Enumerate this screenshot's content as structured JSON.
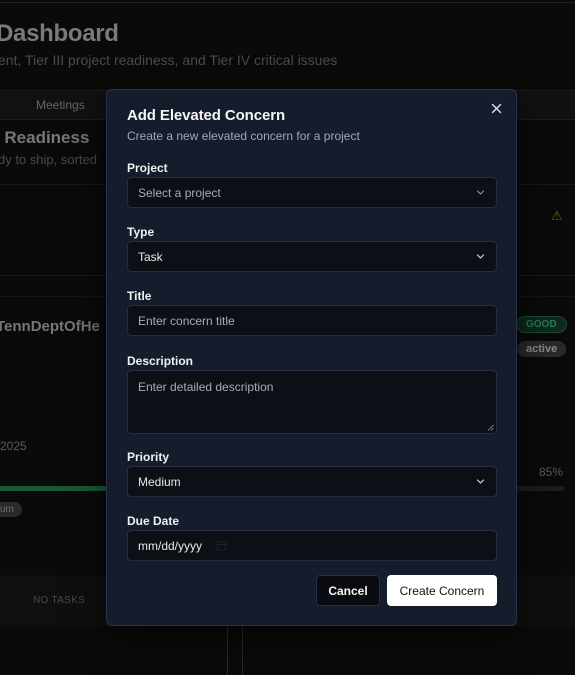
{
  "background": {
    "title": "Dashboard",
    "subtitle": "ent, Tier III project readiness, and Tier IV critical issues",
    "tab": "Meetings",
    "section_title": "t Readiness",
    "section_subtitle": "dy to ship, sorted",
    "project_name": "TennDeptOfHe",
    "badge_good": "GOOD",
    "badge_active": "active",
    "year_text": "2025",
    "percent": "85%",
    "progress_fraction": 0.85,
    "pill_text": "um",
    "no_tasks": "NO TASKS"
  },
  "modal": {
    "title": "Add Elevated Concern",
    "description": "Create a new elevated concern for a project",
    "fields": {
      "project": {
        "label": "Project",
        "placeholder": "Select a project"
      },
      "type": {
        "label": "Type",
        "value": "Task"
      },
      "title": {
        "label": "Title",
        "placeholder": "Enter concern title"
      },
      "description": {
        "label": "Description",
        "placeholder": "Enter detailed description"
      },
      "priority": {
        "label": "Priority",
        "value": "Medium"
      },
      "due_date": {
        "label": "Due Date",
        "placeholder": "mm/dd/yyyy"
      }
    },
    "cancel_label": "Cancel",
    "submit_label": "Create Concern"
  },
  "icons": {
    "close": "close-icon",
    "chevron": "chevron-down-icon",
    "calendar": "calendar-icon",
    "warning": "warning-icon"
  },
  "colors": {
    "modal_bg": "#151c2c",
    "primary_button": "#ffffff",
    "good_badge": "#2c7a54",
    "progress": "#1a5a33"
  }
}
